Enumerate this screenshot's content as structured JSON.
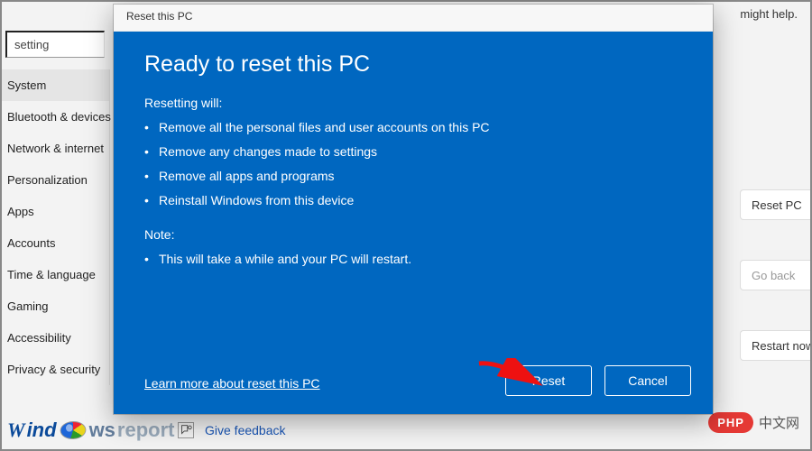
{
  "background": {
    "top_hint": "might help.",
    "search_value": "setting",
    "sidebar_items": [
      "System",
      "Bluetooth & devices",
      "Network & internet",
      "Personalization",
      "Apps",
      "Accounts",
      "Time & language",
      "Gaming",
      "Accessibility",
      "Privacy & security"
    ],
    "selected_index": 0,
    "side_buttons": {
      "reset_pc": "Reset PC",
      "go_back": "Go back",
      "restart_now": "Restart now"
    },
    "feedback_label": "Give feedback"
  },
  "watermarks": {
    "windows_report_text": "ws",
    "windows_report_tail": "report",
    "php_badge": "PHP",
    "php_tail": "中文网"
  },
  "dialog": {
    "titlebar": "Reset this PC",
    "heading": "Ready to reset this PC",
    "intro": "Resetting will:",
    "bullets_a": [
      "Remove all the personal files and user accounts on this PC",
      "Remove any changes made to settings",
      "Remove all apps and programs",
      "Reinstall Windows from this device"
    ],
    "note_header": "Note:",
    "bullets_b": [
      "This will take a while and your PC will restart."
    ],
    "learn_more": "Learn more about reset this PC",
    "reset_button": "Reset",
    "cancel_button": "Cancel"
  }
}
